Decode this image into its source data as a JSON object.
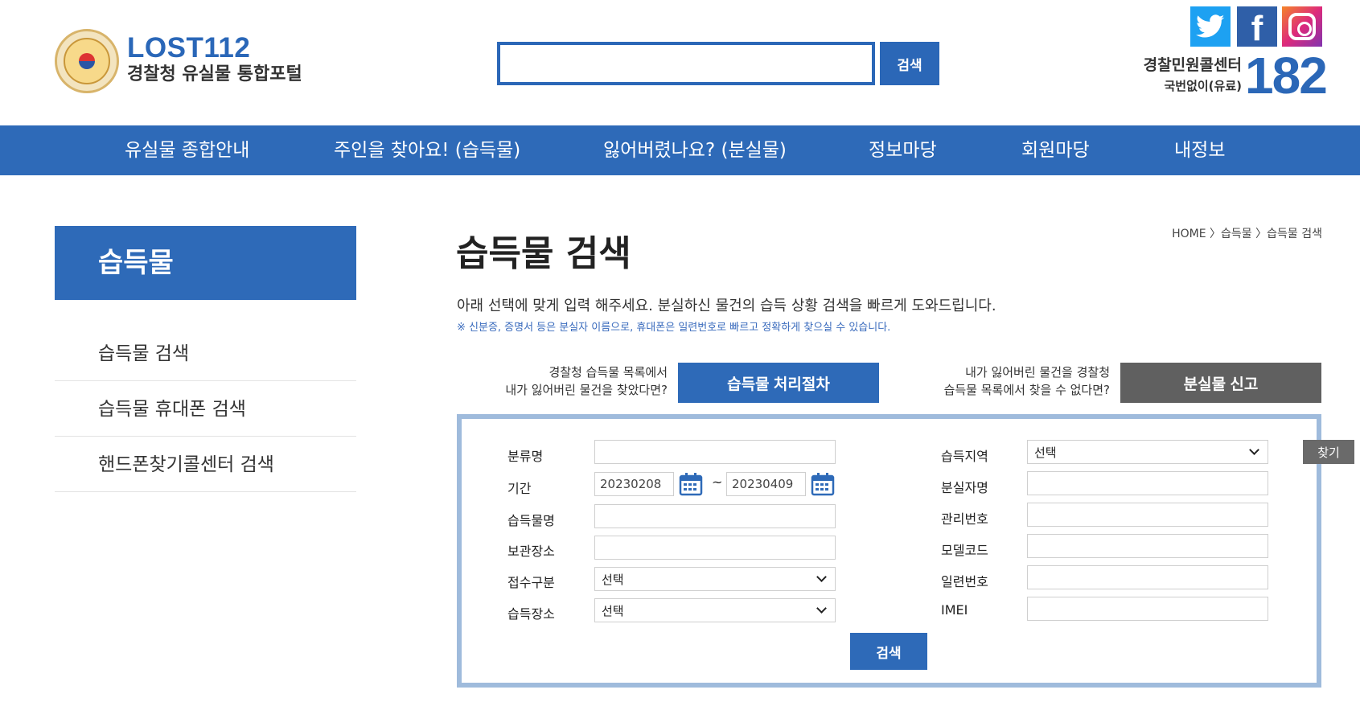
{
  "header": {
    "brand_title": "LOST112",
    "brand_subtitle": "경찰청 유실물 통합포털",
    "search_placeholder": "",
    "search_button": "검색",
    "callcenter_name": "경찰민원콜센터",
    "callcenter_note": "국번없이(유료)",
    "callcenter_number": "182",
    "social": [
      "twitter-icon",
      "facebook-icon",
      "instagram-icon"
    ]
  },
  "nav": {
    "items": [
      "유실물 종합안내",
      "주인을 찾아요! (습득물)",
      "잃어버렸나요? (분실물)",
      "정보마당",
      "회원마당",
      "내정보"
    ]
  },
  "sidebar": {
    "title": "습득물",
    "items": [
      "습득물 검색",
      "습득물 휴대폰 검색",
      "핸드폰찾기콜센터 검색"
    ]
  },
  "main": {
    "breadcrumb": "HOME 〉습득물 〉습득물 검색",
    "title": "습득물 검색",
    "description": "아래 선택에 맞게 입력 해주세요. 분실하신 물건의 습득 상황 검색을 빠르게 도와드립니다.",
    "notice": "※ 신분증, 증명서 등은 분실자 이름으로, 휴대폰은 일련번호로 빠르고 정확하게 찾으실 수 있습니다.",
    "guide_left_line1": "경찰청 습득물 목록에서",
    "guide_left_line2": "내가 잃어버린 물건을 찾았다면?",
    "process_button": "습득물 처리절차",
    "guide_right_line1": "내가 잃어버린 물건을 경찰청",
    "guide_right_line2": "습득물 목록에서 찾을 수 없다면?",
    "lost_report_button": "분실물 신고"
  },
  "form": {
    "category_label": "분류명",
    "category_value": "",
    "find_button": "찾기",
    "period_label": "기간",
    "date_from": "20230208",
    "date_separator": "~",
    "date_to": "20230409",
    "item_name_label": "습득물명",
    "storage_label": "보관장소",
    "receipt_type_label": "접수구분",
    "receipt_type_value": "선택",
    "found_place_label": "습득장소",
    "found_place_value": "선택",
    "region_label": "습득지역",
    "region_value": "선택",
    "owner_label": "분실자명",
    "manage_no_label": "관리번호",
    "model_code_label": "모델코드",
    "serial_label": "일련번호",
    "imei_label": "IMEI",
    "search_button": "검색"
  },
  "colors": {
    "primary": "#2e6ab8",
    "box_border": "#9fbbdc",
    "gray_button": "#606060"
  }
}
